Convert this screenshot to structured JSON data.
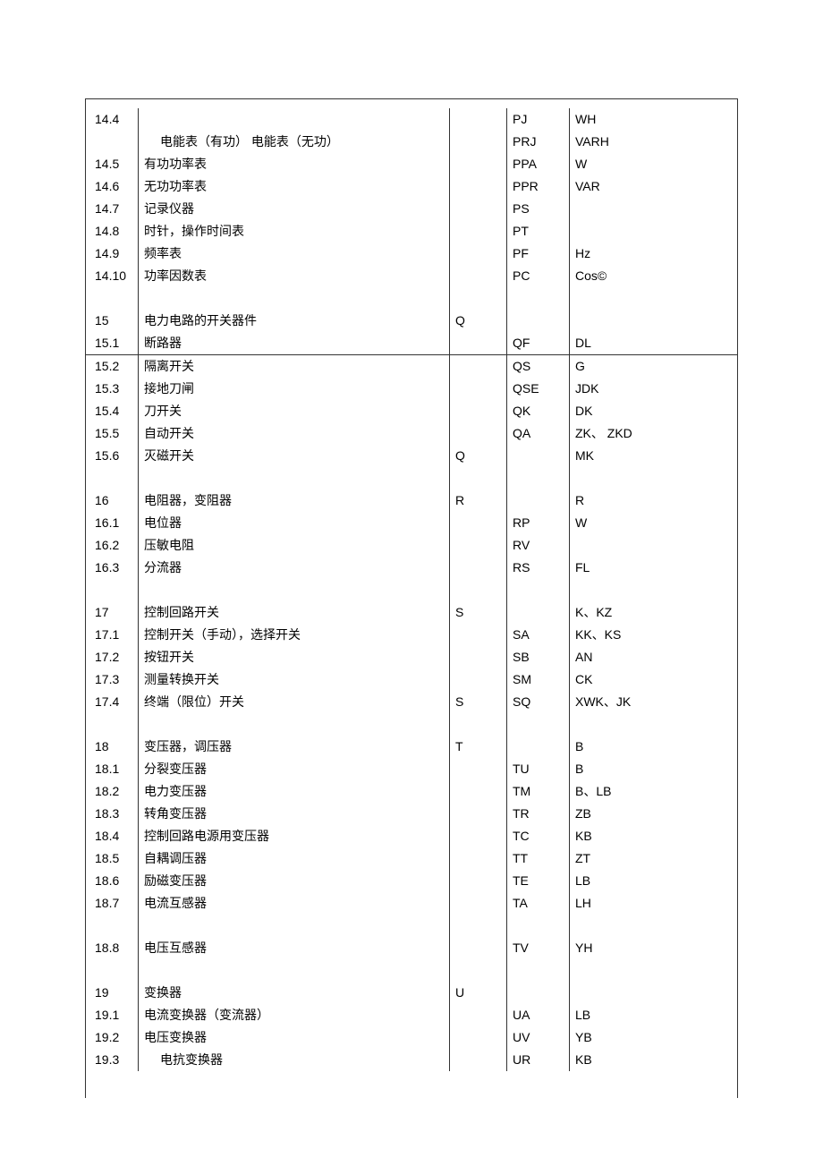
{
  "rows": [
    {
      "type": "data",
      "num": "14.4",
      "name": "",
      "cat": "",
      "code": "PJ",
      "old": "WH"
    },
    {
      "type": "data",
      "num": "",
      "name": "电能表（有功） 电能表（无功）",
      "indent": true,
      "cat": "",
      "code": "PRJ",
      "old": "VARH"
    },
    {
      "type": "data",
      "num": "14.5",
      "name": "有功功率表",
      "cat": "",
      "code": "PPA",
      "old": "W"
    },
    {
      "type": "data",
      "num": "14.6",
      "name": "无功功率表",
      "cat": "",
      "code": "PPR",
      "old": "VAR"
    },
    {
      "type": "data",
      "num": "14.7",
      "name": "记录仪器",
      "cat": "",
      "code": "PS",
      "old": ""
    },
    {
      "type": "data",
      "num": "14.8",
      "name": "时针，操作时间表",
      "cat": "",
      "code": "PT",
      "old": ""
    },
    {
      "type": "data",
      "num": "14.9",
      "name": "频率表",
      "cat": "",
      "code": "PF",
      "old": "Hz"
    },
    {
      "type": "data",
      "num": "14.10",
      "name": "功率因数表",
      "cat": "",
      "code": "PC",
      "old": "Cos©"
    },
    {
      "type": "blank"
    },
    {
      "type": "data",
      "num": "15",
      "name": "电力电路的开关器件",
      "cat": "Q",
      "code": "",
      "old": ""
    },
    {
      "type": "data",
      "num": "15.1",
      "name": "断路器",
      "cat": "",
      "code": "QF",
      "old": "DL"
    },
    {
      "type": "hr"
    },
    {
      "type": "data",
      "num": "15.2",
      "name": "隔离开关",
      "cat": "",
      "code": "QS",
      "old": "G"
    },
    {
      "type": "data",
      "num": "15.3",
      "name": "接地刀闸",
      "cat": "",
      "code": "QSE",
      "old": "JDK"
    },
    {
      "type": "data",
      "num": "15.4",
      "name": "刀开关",
      "cat": "",
      "code": "QK",
      "old": "DK"
    },
    {
      "type": "data",
      "num": "15.5",
      "name": "自动开关",
      "cat": "",
      "code": "QA",
      "old": "ZK、 ZKD"
    },
    {
      "type": "data",
      "num": "15.6",
      "name": "灭磁开关",
      "cat": "Q",
      "code": "",
      "old": "MK"
    },
    {
      "type": "blank"
    },
    {
      "type": "data",
      "num": "16",
      "name": "电阻器，变阻器",
      "cat": "R",
      "code": "",
      "old": "R"
    },
    {
      "type": "data",
      "num": "16.1",
      "name": "电位器",
      "cat": "",
      "code": "RP",
      "old": "W"
    },
    {
      "type": "data",
      "num": "16.2",
      "name": "压敏电阻",
      "cat": "",
      "code": "RV",
      "old": ""
    },
    {
      "type": "data",
      "num": "16.3",
      "name": "分流器",
      "cat": "",
      "code": "RS",
      "old": "FL"
    },
    {
      "type": "blank"
    },
    {
      "type": "data",
      "num": "17",
      "name": "控制回路开关",
      "cat": "S",
      "code": "",
      "old": "K、KZ"
    },
    {
      "type": "data",
      "num": "17.1",
      "name": "控制开关（手动），选择开关",
      "cat": "",
      "code": "SA",
      "old": "KK、KS"
    },
    {
      "type": "data",
      "num": "17.2",
      "name": "按钮开关",
      "cat": "",
      "code": "SB",
      "old": "AN"
    },
    {
      "type": "data",
      "num": "17.3",
      "name": "测量转换开关",
      "cat": "",
      "code": "SM",
      "old": "CK"
    },
    {
      "type": "data",
      "num": "17.4",
      "name": "终端（限位）开关",
      "cat": "S",
      "code": "SQ",
      "old": "XWK、JK"
    },
    {
      "type": "blank"
    },
    {
      "type": "data",
      "num": "18",
      "name": "变压器，调压器",
      "cat": "T",
      "code": "",
      "old": "B"
    },
    {
      "type": "data",
      "num": "18.1",
      "name": "分裂变压器",
      "cat": "",
      "code": "TU",
      "old": "B"
    },
    {
      "type": "data",
      "num": "18.2",
      "name": "电力变压器",
      "cat": "",
      "code": "TM",
      "old": "B、LB"
    },
    {
      "type": "data",
      "num": "18.3",
      "name": "转角变压器",
      "cat": "",
      "code": "TR",
      "old": "ZB"
    },
    {
      "type": "data",
      "num": "18.4",
      "name": "控制回路电源用变压器",
      "cat": "",
      "code": "TC",
      "old": "KB"
    },
    {
      "type": "data",
      "num": "18.5",
      "name": "自耦调压器",
      "cat": "",
      "code": "TT",
      "old": "ZT"
    },
    {
      "type": "data",
      "num": "18.6",
      "name": "励磁变压器",
      "cat": "",
      "code": "TE",
      "old": "LB"
    },
    {
      "type": "data",
      "num": "18.7",
      "name": "电流互感器",
      "cat": "",
      "code": "TA",
      "old": "LH"
    },
    {
      "type": "half"
    },
    {
      "type": "data",
      "num": "18.8",
      "name": "电压互感器",
      "cat": "",
      "code": "TV",
      "old": "YH"
    },
    {
      "type": "blank"
    },
    {
      "type": "data",
      "num": "19",
      "name": "变换器",
      "cat": "U",
      "code": "",
      "old": ""
    },
    {
      "type": "data",
      "num": "19.1",
      "name": "电流变换器（变流器）",
      "cat": "",
      "code": "UA",
      "old": "LB"
    },
    {
      "type": "data",
      "num": "19.2",
      "name": "电压变换器",
      "cat": "",
      "code": "UV",
      "old": "YB"
    },
    {
      "type": "data",
      "num": "19.3",
      "name": "电抗变换器",
      "indent": true,
      "cat": "",
      "code": "UR",
      "old": "KB"
    }
  ]
}
